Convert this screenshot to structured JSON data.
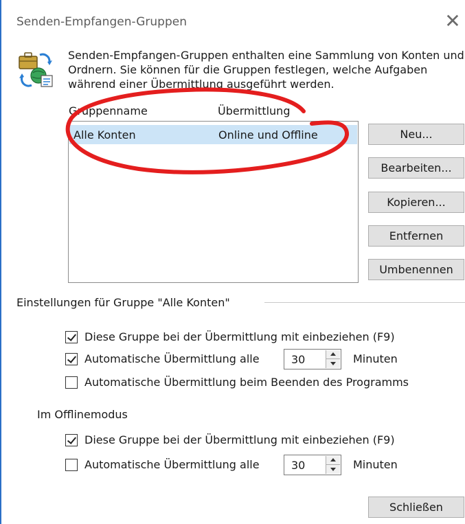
{
  "window": {
    "title": "Senden-Empfangen-Gruppen",
    "close_glyph": "✕"
  },
  "description": "Senden-Empfangen-Gruppen enthalten eine Sammlung von Konten und Ordnern. Sie können für die Gruppen festlegen, welche Aufgaben während einer Übermittlung ausgeführt werden.",
  "list": {
    "headers": {
      "name": "Gruppenname",
      "transfer": "Übermittlung"
    },
    "rows": [
      {
        "name": "Alle Konten",
        "transfer": "Online und Offline",
        "selected": true
      }
    ]
  },
  "buttons": {
    "new": "Neu...",
    "edit": "Bearbeiten...",
    "copy": "Kopieren...",
    "remove": "Entfernen",
    "rename": "Umbenennen",
    "close": "Schließen"
  },
  "group_settings": {
    "title": "Einstellungen für Gruppe \"Alle Konten\"",
    "include": {
      "label": "Diese Gruppe bei der Übermittlung mit einbeziehen (F9)",
      "checked": true
    },
    "auto": {
      "label": "Automatische Übermittlung alle",
      "checked": true,
      "value": "30",
      "unit": "Minuten"
    },
    "on_exit": {
      "label": "Automatische Übermittlung beim Beenden des Programms",
      "checked": false
    }
  },
  "offline": {
    "title": "Im Offlinemodus",
    "include": {
      "label": "Diese Gruppe bei der Übermittlung mit einbeziehen (F9)",
      "checked": true
    },
    "auto": {
      "label": "Automatische Übermittlung alle",
      "checked": false,
      "value": "30",
      "unit": "Minuten"
    }
  },
  "colors": {
    "selection": "#cce4f7",
    "window_border": "#2b6fc7",
    "annotation": "#e41e1e"
  }
}
